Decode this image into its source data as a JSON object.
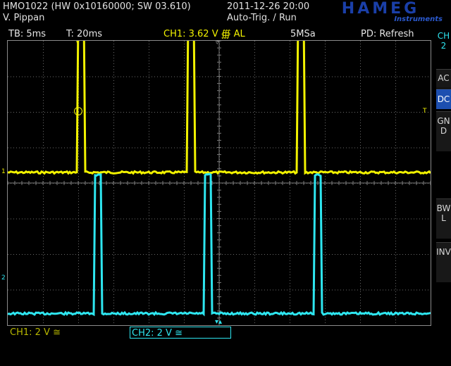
{
  "header": {
    "model_line": "HMO1022 (HW 0x10160000; SW 03.610)",
    "user": "V. Pippan",
    "datetime": "2011-12-26 20:00",
    "trigger_status": "Auto-Trig. / Run",
    "brand": "HAMEG",
    "brand_sub": "Instruments",
    "brand_color": "#1a3fa8"
  },
  "status_bar": {
    "timebase": "TB: 5ms",
    "trigger_time": "T: 20ms",
    "ch1_trigger": "CH1: 3.62 V ∰ AL",
    "sample_rate": "5MSa",
    "display_mode": "PD: Refresh"
  },
  "side_menu": {
    "channel_tab": "CH2",
    "buttons": [
      {
        "label": "AC",
        "active": false
      },
      {
        "label": "DC",
        "active": true
      },
      {
        "label": "GND",
        "active": false
      },
      {
        "label": "BWL",
        "active": false
      },
      {
        "label": "INV",
        "active": false
      }
    ]
  },
  "markers": {
    "ch1_marker": "1",
    "ch2_marker": "2",
    "trigger_marker": "T"
  },
  "bottom": {
    "ch1_scale": "CH1: 2 V ≅",
    "ch2_scale": "CH2: 2 V ≅"
  },
  "colors": {
    "ch1": "#f2f200",
    "ch2": "#2ee6f0",
    "active_button": "#1d4fb0",
    "grid": "#6a6a6a"
  },
  "trace_data": {
    "ch1_pulses_ms": [
      [
        0.0,
        0.9
      ],
      [
        15.6,
        16.5
      ],
      [
        31.2,
        32.1
      ]
    ],
    "ch2_pulses_ms": [
      [
        2.4,
        3.3
      ],
      [
        18.0,
        18.9
      ],
      [
        33.6,
        34.5
      ]
    ],
    "ch1_high_div": 4.4,
    "ch1_low_div": 0.1,
    "ch2_high_div": 3.0,
    "ch2_low_div": -0.9
  }
}
